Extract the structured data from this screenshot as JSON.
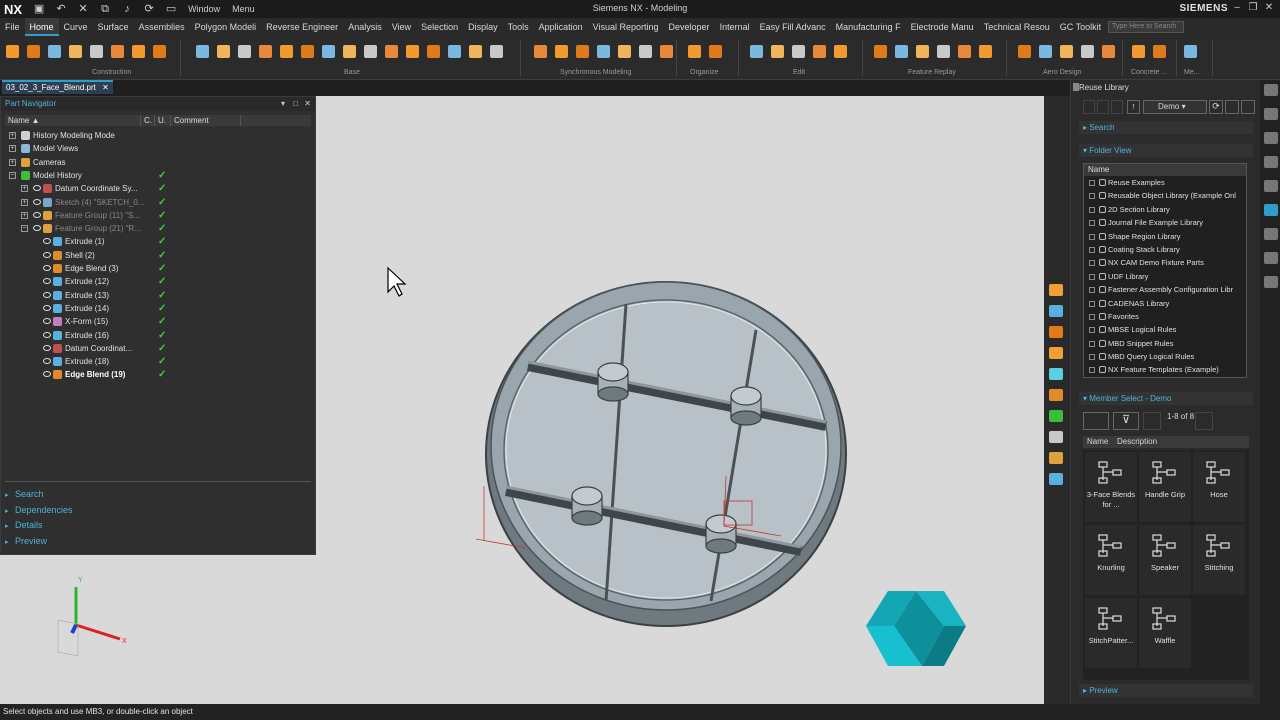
{
  "app": {
    "logo": "NX",
    "window_title": "Siemens NX - Modeling",
    "brand": "SIEMENS",
    "quick_window": "Window",
    "quick_menu": "Menu"
  },
  "menu": {
    "items": [
      "File",
      "Home",
      "Curve",
      "Surface",
      "Assemblies",
      "Polygon Modeli",
      "Reverse Engineer",
      "Analysis",
      "View",
      "Selection",
      "Display",
      "Tools",
      "Application",
      "Visual Reporting",
      "Developer",
      "Internal",
      "Easy Fill Advanc",
      "Manufacturing F",
      "Electrode Manu",
      "Technical Resou",
      "GC Toolkit"
    ],
    "active": "Home",
    "search_placeholder": "Type Here to Search"
  },
  "ribbon": {
    "groups": [
      "Construction",
      "Base",
      "Synchronous Modeling",
      "Organize",
      "Edit",
      "Feature Replay",
      "Aero Design",
      "Concrete ...",
      "Me..."
    ]
  },
  "file_tab": {
    "label": "03_02_3_Face_Blend.prt"
  },
  "part_navigator": {
    "title": "Part Navigator",
    "columns": {
      "name": "Name",
      "c": "C.",
      "u": "U.",
      "comment": "Comment"
    },
    "rows": [
      {
        "label": "History Modeling Mode",
        "indent": 0,
        "checked": false,
        "dim": false
      },
      {
        "label": "Model Views",
        "indent": 0,
        "checked": false,
        "dim": false
      },
      {
        "label": "Cameras",
        "indent": 0,
        "checked": false,
        "dim": false
      },
      {
        "label": "Model History",
        "indent": 0,
        "checked": true,
        "dim": false
      },
      {
        "label": "Datum Coordinate Sy...",
        "indent": 1,
        "checked": true,
        "dim": false
      },
      {
        "label": "Sketch (4) \"SKETCH_0...",
        "indent": 1,
        "checked": true,
        "dim": true
      },
      {
        "label": "Feature Group (11) \"S...",
        "indent": 1,
        "checked": true,
        "dim": true
      },
      {
        "label": "Feature Group (21) \"R...",
        "indent": 1,
        "checked": true,
        "dim": true
      },
      {
        "label": "Extrude (1)",
        "indent": 2,
        "checked": true,
        "dim": false
      },
      {
        "label": "Shell (2)",
        "indent": 2,
        "checked": true,
        "dim": false
      },
      {
        "label": "Edge Blend (3)",
        "indent": 2,
        "checked": true,
        "dim": false
      },
      {
        "label": "Extrude (12)",
        "indent": 2,
        "checked": true,
        "dim": false
      },
      {
        "label": "Extrude (13)",
        "indent": 2,
        "checked": true,
        "dim": false
      },
      {
        "label": "Extrude (14)",
        "indent": 2,
        "checked": true,
        "dim": false
      },
      {
        "label": "X-Form (15)",
        "indent": 2,
        "checked": true,
        "dim": false
      },
      {
        "label": "Extrude (16)",
        "indent": 2,
        "checked": true,
        "dim": false
      },
      {
        "label": "Datum Coordinat...",
        "indent": 2,
        "checked": true,
        "dim": false
      },
      {
        "label": "Extrude (18)",
        "indent": 2,
        "checked": true,
        "dim": false
      },
      {
        "label": "Edge Blend (19)",
        "indent": 2,
        "checked": true,
        "dim": false,
        "bold": true
      }
    ],
    "sections": [
      "Search",
      "Dependencies",
      "Details",
      "Preview"
    ]
  },
  "reuse_library": {
    "title": "Reuse Library",
    "dropdown": "Demo",
    "search_label": "Search",
    "folder_view_label": "Folder View",
    "folder_header": "Name",
    "folders": [
      "Reuse Examples",
      "Reusable Object Library (Example Onl",
      "2D Section Library",
      "Journal File Example Library",
      "Shape Region Library",
      "Coating Stack Library",
      "NX CAM Demo Fixture Parts",
      "UDF Library",
      "Fastener Assembly Configuration Libr",
      "CADENAS Library",
      "Favorites",
      "MBSE Logical Rules",
      "MBD Snippet Rules",
      "MBD Query Logical Rules",
      "NX Feature Templates (Example)"
    ],
    "member_select_label": "Member Select - Demo",
    "member_count": "1-8 of 8",
    "member_columns": [
      "Name",
      "Description"
    ],
    "members": [
      "3-Face Blends for ...",
      "Handle Grip",
      "Hose",
      "Knurling",
      "Speaker",
      "Stitching",
      "StitchPatter...",
      "Waffle"
    ],
    "preview_label": "Preview"
  },
  "status": {
    "text": "Select objects and use MB3, or double-click an object"
  },
  "colors": {
    "accent": "#2f9ecb",
    "check": "#3bd13b",
    "viewport_bg": "#d9d9d9",
    "part": "#8e9aa2"
  }
}
